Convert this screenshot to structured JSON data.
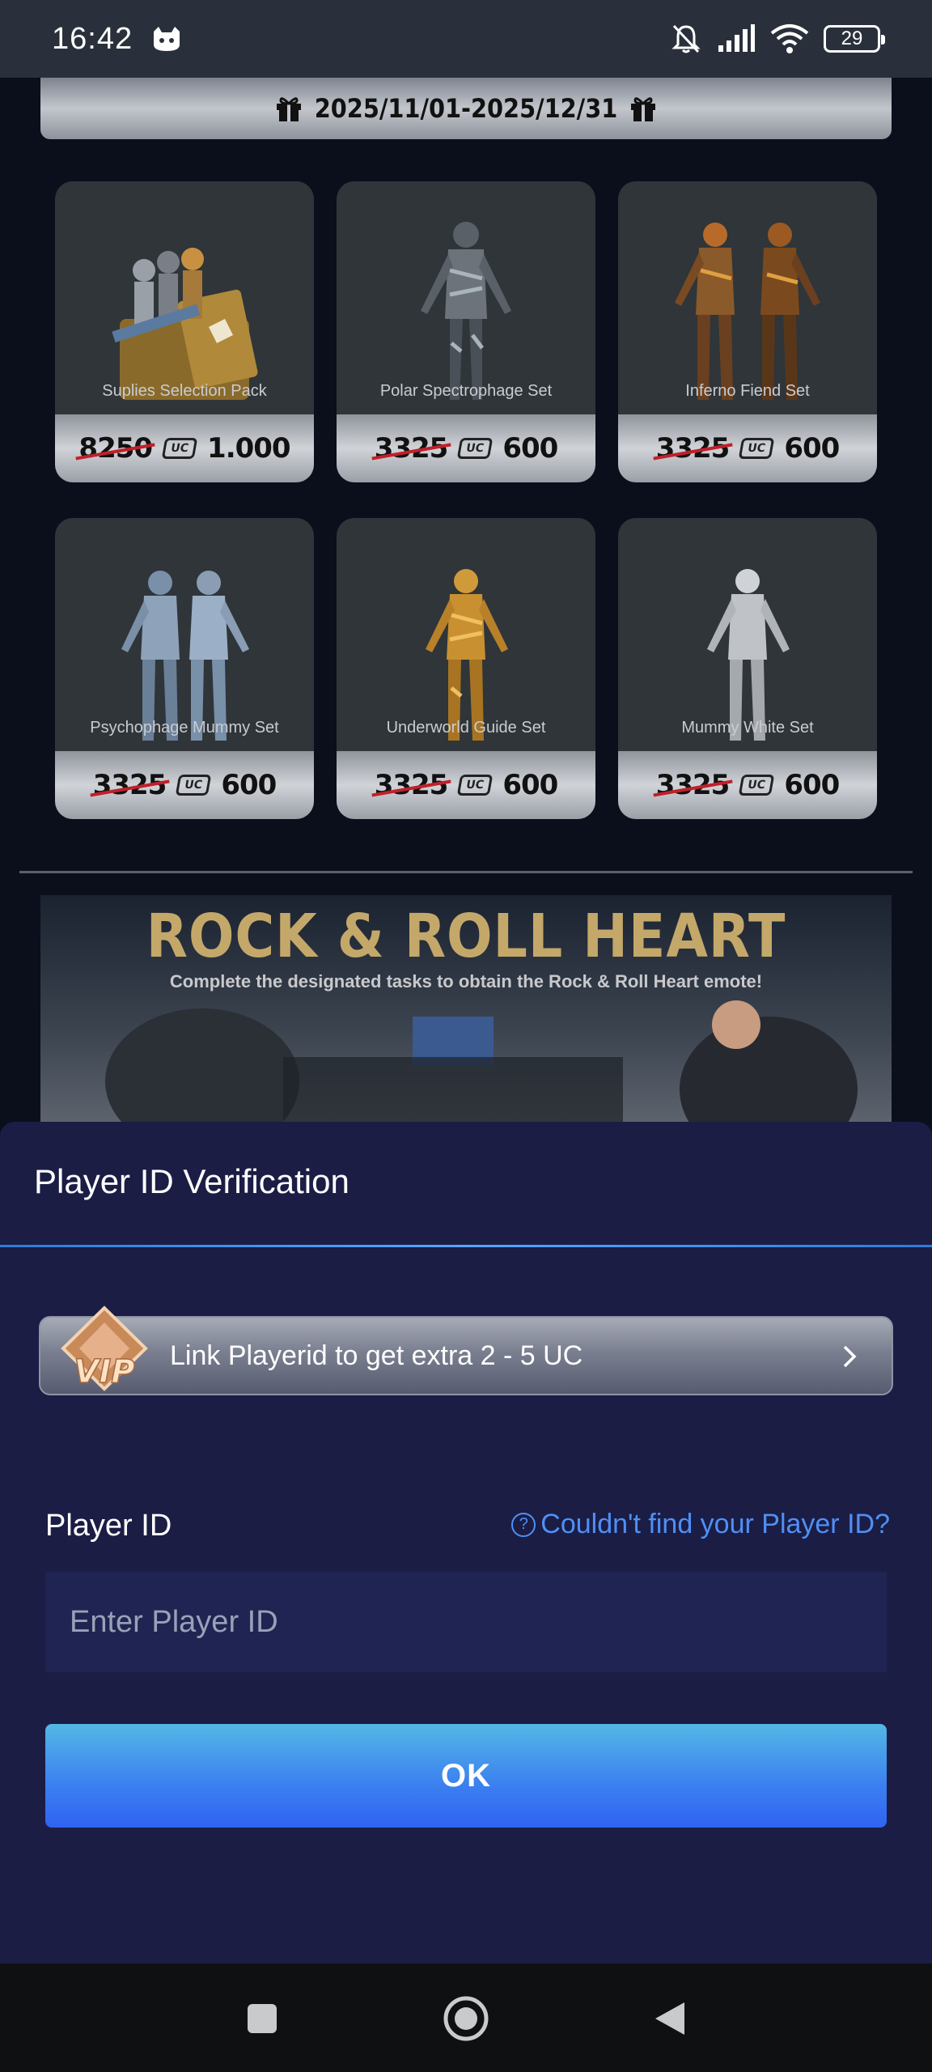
{
  "status_bar": {
    "time": "16:42",
    "battery": "29",
    "icons": [
      "cat-app-icon",
      "mute-bell-icon",
      "signal-icon",
      "wifi-icon",
      "battery-icon"
    ]
  },
  "date_banner": {
    "text": "2025/11/01-2025/12/31",
    "icon": "gift-icon"
  },
  "items": [
    {
      "name": "Suplies Selection Pack",
      "old_price": "8250",
      "price": "1.000",
      "currency": "UC"
    },
    {
      "name": "Polar Spectrophage Set",
      "old_price": "3325",
      "price": "600",
      "currency": "UC"
    },
    {
      "name": "Inferno Fiend Set",
      "old_price": "3325",
      "price": "600",
      "currency": "UC"
    },
    {
      "name": "Psychophage Mummy Set",
      "old_price": "3325",
      "price": "600",
      "currency": "UC"
    },
    {
      "name": "Underworld Guide Set",
      "old_price": "3325",
      "price": "600",
      "currency": "UC"
    },
    {
      "name": "Mummy White Set",
      "old_price": "3325",
      "price": "600",
      "currency": "UC"
    }
  ],
  "event_banner": {
    "title": "ROCK & ROLL HEART",
    "subtitle": "Complete the designated tasks to obtain the Rock & Roll Heart emote!"
  },
  "dialog": {
    "title": "Player ID Verification",
    "vip": {
      "badge_text": "VIP",
      "text": "Link Playerid to get extra 2 - 5 UC"
    },
    "player_id_label": "Player ID",
    "help_link": "Couldn't find your Player ID?",
    "input_placeholder": "Enter Player ID",
    "input_value": "",
    "ok_label": "OK"
  },
  "colors": {
    "accent": "#3b7ff0",
    "link": "#4f8ff5",
    "sheet_bg": "#1b1d45",
    "strike": "#c0202a"
  }
}
